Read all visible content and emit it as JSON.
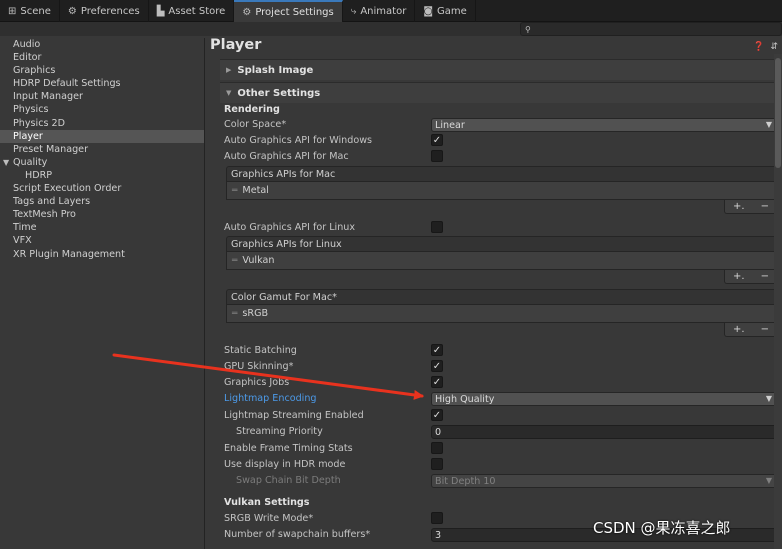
{
  "tabs": [
    {
      "label": "Scene",
      "icon": "grid-icon",
      "glyph": "⊞"
    },
    {
      "label": "Preferences",
      "icon": "gear-icon",
      "glyph": "⚙"
    },
    {
      "label": "Asset Store",
      "icon": "store-icon",
      "glyph": "▙"
    },
    {
      "label": "Project Settings",
      "icon": "gear-icon",
      "glyph": "⚙"
    },
    {
      "label": "Animator",
      "icon": "animator-icon",
      "glyph": "⤷"
    },
    {
      "label": "Game",
      "icon": "gamepad-icon",
      "glyph": "◙"
    }
  ],
  "active_tab": "Project Settings",
  "search": {
    "glyph": "⚲",
    "value": ""
  },
  "sidebar": {
    "items": [
      {
        "label": "Audio"
      },
      {
        "label": "Editor"
      },
      {
        "label": "Graphics"
      },
      {
        "label": "HDRP Default Settings"
      },
      {
        "label": "Input Manager"
      },
      {
        "label": "Physics"
      },
      {
        "label": "Physics 2D"
      },
      {
        "label": "Player",
        "active": true
      },
      {
        "label": "Preset Manager"
      },
      {
        "label": "Quality",
        "group": true
      },
      {
        "label": "HDRP",
        "sub": true
      },
      {
        "label": "Script Execution Order"
      },
      {
        "label": "Tags and Layers"
      },
      {
        "label": "TextMesh Pro"
      },
      {
        "label": "Time"
      },
      {
        "label": "VFX"
      },
      {
        "label": "XR Plugin Management"
      }
    ]
  },
  "main": {
    "title": "Player",
    "help_glyph": "❓",
    "settings_glyph": "⇵",
    "splash_label": "Splash Image",
    "other_label": "Other Settings",
    "rendering_label": "Rendering",
    "color_space": {
      "label": "Color Space*",
      "value": "Linear"
    },
    "auto_gfx_windows": {
      "label": "Auto Graphics API  for Windows",
      "checked": true
    },
    "auto_gfx_mac": {
      "label": "Auto Graphics API  for Mac",
      "checked": false
    },
    "gfx_mac_list": {
      "header": "Graphics APIs for Mac",
      "item": "Metal"
    },
    "auto_gfx_linux": {
      "label": "Auto Graphics API  for Linux",
      "checked": false
    },
    "gfx_linux_list": {
      "header": "Graphics APIs for Linux",
      "item": "Vulkan"
    },
    "gamut_list": {
      "header": "Color Gamut For Mac*",
      "item": "sRGB"
    },
    "list_add": "+.",
    "list_remove": "−",
    "static_batching": {
      "label": "Static Batching",
      "checked": true
    },
    "gpu_skinning": {
      "label": "GPU Skinning*",
      "checked": true
    },
    "graphics_jobs": {
      "label": "Graphics Jobs",
      "checked": true
    },
    "lightmap_encoding": {
      "label": "Lightmap Encoding",
      "value": "High Quality"
    },
    "lightmap_streaming": {
      "label": "Lightmap Streaming Enabled",
      "checked": true
    },
    "streaming_priority": {
      "label": "Streaming Priority",
      "value": "0"
    },
    "frame_timing": {
      "label": "Enable Frame Timing Stats",
      "checked": false
    },
    "hdr_display": {
      "label": "Use display in HDR mode",
      "checked": false
    },
    "swap_chain": {
      "label": "Swap Chain Bit Depth",
      "value": "Bit Depth 10"
    },
    "vulkan_label": "Vulkan Settings",
    "srgb_write": {
      "label": "SRGB Write Mode*",
      "checked": false
    },
    "swapchain_buffers": {
      "label": "Number of swapchain buffers*",
      "value": "3"
    }
  },
  "watermark": "CSDN @果冻喜之郎",
  "colors": {
    "annotation_arrow": "#e8321e",
    "highlight_label": "#4c9ae8",
    "active_tab_accent": "#3a79bb"
  }
}
